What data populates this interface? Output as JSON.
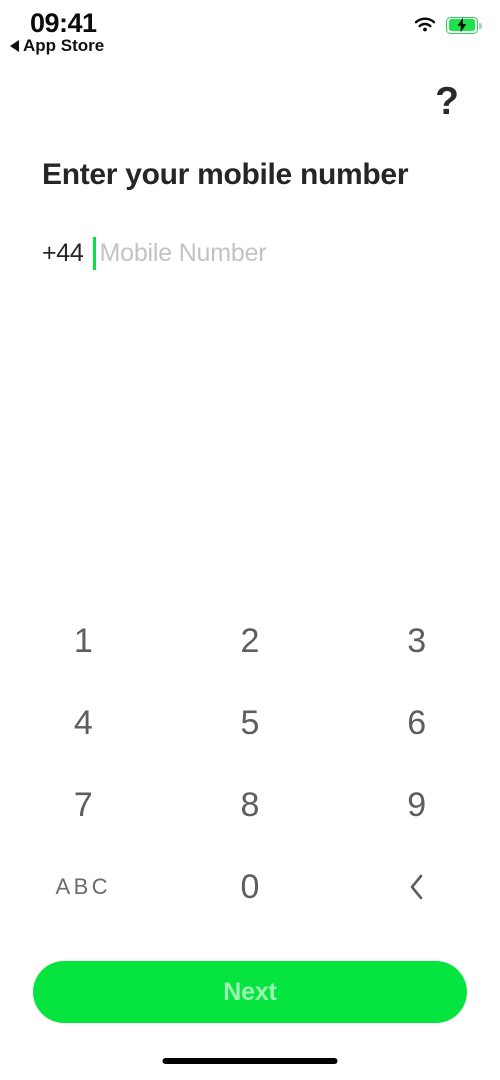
{
  "status_bar": {
    "time": "09:41",
    "back_label": "App Store",
    "back_icon": "triangle-left-icon",
    "wifi_icon": "wifi-icon",
    "battery_icon": "battery-charging-icon",
    "battery_color": "#1ee24a"
  },
  "header": {
    "help_label": "?"
  },
  "main": {
    "title": "Enter your mobile number",
    "country_prefix": "+44",
    "phone_placeholder": "Mobile Number",
    "phone_value": "",
    "caret_color": "#07e03e"
  },
  "keypad": {
    "rows": [
      [
        {
          "label": "1",
          "name": "key-1"
        },
        {
          "label": "2",
          "name": "key-2"
        },
        {
          "label": "3",
          "name": "key-3"
        }
      ],
      [
        {
          "label": "4",
          "name": "key-4"
        },
        {
          "label": "5",
          "name": "key-5"
        },
        {
          "label": "6",
          "name": "key-6"
        }
      ],
      [
        {
          "label": "7",
          "name": "key-7"
        },
        {
          "label": "8",
          "name": "key-8"
        },
        {
          "label": "9",
          "name": "key-9"
        }
      ],
      [
        {
          "label": "ABC",
          "name": "key-abc"
        },
        {
          "label": "0",
          "name": "key-0"
        },
        {
          "label": "",
          "name": "key-backspace",
          "icon": "chevron-left-icon"
        }
      ]
    ]
  },
  "footer": {
    "next_label": "Next",
    "next_color": "#06e440"
  }
}
